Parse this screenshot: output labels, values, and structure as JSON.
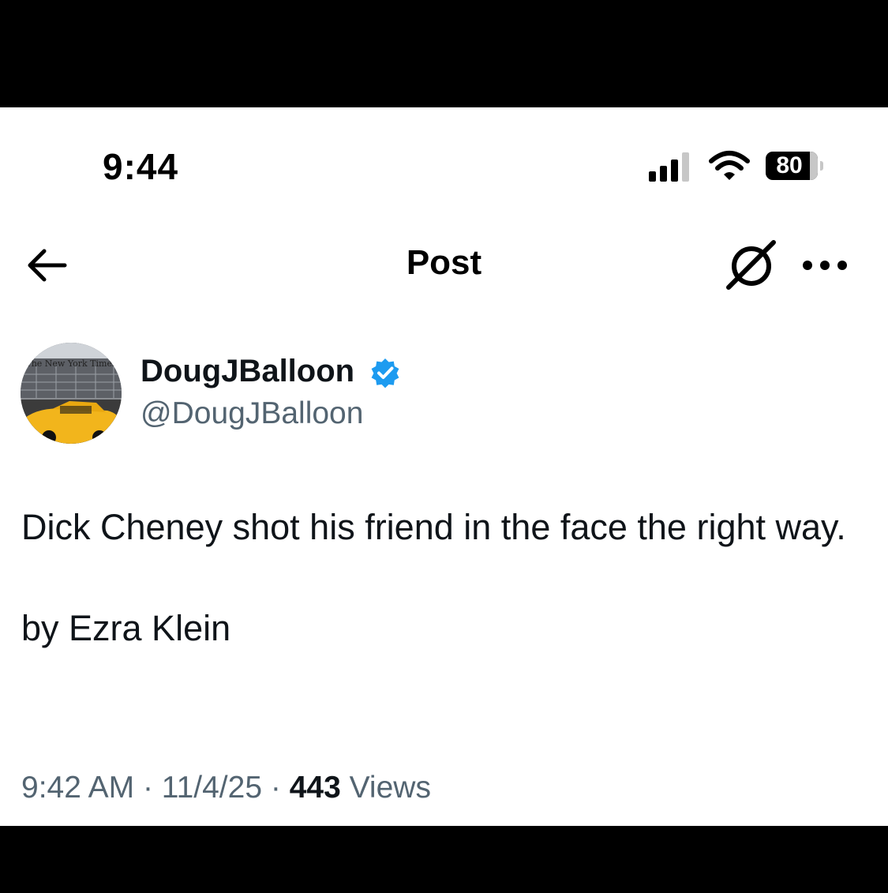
{
  "status_bar": {
    "time": "9:44",
    "battery_level": "80",
    "signal_bars_active": 3,
    "signal_bars_total": 4
  },
  "nav": {
    "back_icon": "arrow-left-icon",
    "title": "Post",
    "grok_icon": "grok-icon",
    "more_icon": "more-horizontal-icon"
  },
  "author": {
    "display_name": "DougJBalloon",
    "handle": "@DougJBalloon",
    "verified": true,
    "verified_color": "#1d9bf0",
    "avatar_wordmark": "The New York Times"
  },
  "tweet": {
    "line1": "Dick Cheney shot his friend in the face the right way.",
    "line2": "by Ezra Klein"
  },
  "meta": {
    "time": "9:42 AM",
    "date": "11/4/25",
    "separator": "·",
    "views_count": "443",
    "views_label": "Views"
  },
  "colors": {
    "text_primary": "#0f1419",
    "text_secondary": "#536471",
    "accent": "#1d9bf0"
  }
}
